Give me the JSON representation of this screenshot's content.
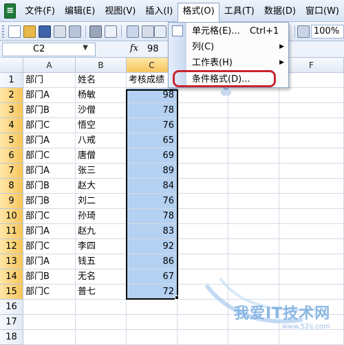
{
  "menubar": {
    "items": [
      {
        "label": "文件(F)"
      },
      {
        "label": "编辑(E)"
      },
      {
        "label": "视图(V)"
      },
      {
        "label": "插入(I)"
      },
      {
        "label": "格式(O)",
        "active": true
      },
      {
        "label": "工具(T)"
      },
      {
        "label": "数据(D)"
      },
      {
        "label": "窗口(W)"
      }
    ]
  },
  "toolbar": {
    "zoom": "100%"
  },
  "formula_bar": {
    "name_box": "C2",
    "fx_symbol": "fx",
    "value": "98"
  },
  "format_menu": {
    "items": [
      {
        "label": "单元格(E)...",
        "shortcut": "Ctrl+1"
      },
      {
        "label": "列(C)",
        "submenu": true
      },
      {
        "label": "工作表(H)",
        "submenu": true
      },
      {
        "label": "条件格式(D)...",
        "highlighted": true
      }
    ],
    "expand_icon": "double-chevron-down-icon"
  },
  "sheet": {
    "columns": [
      "A",
      "B",
      "C",
      "F"
    ],
    "header_row": {
      "num": "1",
      "a": "部门",
      "b": "姓名",
      "c": "考核成绩"
    },
    "rows": [
      {
        "num": "2",
        "a": "部门A",
        "b": "杨敏",
        "c": "98"
      },
      {
        "num": "3",
        "a": "部门B",
        "b": "沙僧",
        "c": "78"
      },
      {
        "num": "4",
        "a": "部门C",
        "b": "悟空",
        "c": "76"
      },
      {
        "num": "5",
        "a": "部门A",
        "b": "八戒",
        "c": "65"
      },
      {
        "num": "6",
        "a": "部门C",
        "b": "唐僧",
        "c": "69"
      },
      {
        "num": "7",
        "a": "部门A",
        "b": "张三",
        "c": "89"
      },
      {
        "num": "8",
        "a": "部门B",
        "b": "赵大",
        "c": "84"
      },
      {
        "num": "9",
        "a": "部门B",
        "b": "刘二",
        "c": "76"
      },
      {
        "num": "10",
        "a": "部门C",
        "b": "孙琦",
        "c": "78"
      },
      {
        "num": "11",
        "a": "部门A",
        "b": "赵九",
        "c": "83"
      },
      {
        "num": "12",
        "a": "部门C",
        "b": "李四",
        "c": "92"
      },
      {
        "num": "13",
        "a": "部门A",
        "b": "钱五",
        "c": "86"
      },
      {
        "num": "14",
        "a": "部门B",
        "b": "无名",
        "c": "67"
      },
      {
        "num": "15",
        "a": "部门C",
        "b": "普七",
        "c": "72"
      }
    ],
    "empty_rows": [
      "16",
      "17",
      "18"
    ]
  },
  "watermark": {
    "text": "我爱IT技术网",
    "url": "www.52ij.com"
  },
  "colors": {
    "selection": "#b5d1f2",
    "highlight_ring": "#c8242f",
    "menu_border": "#8aa3c8"
  }
}
